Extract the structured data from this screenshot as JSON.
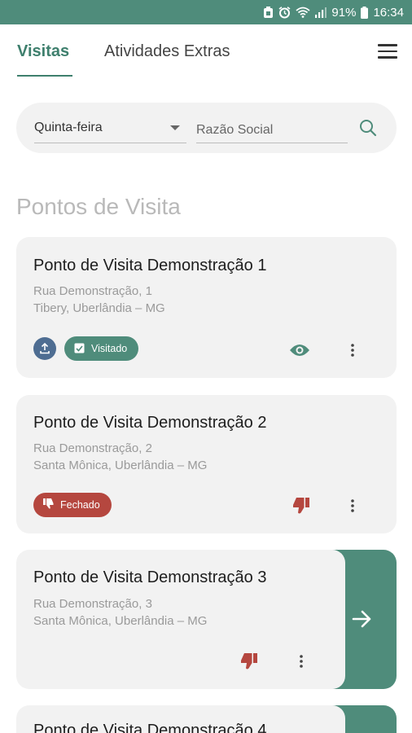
{
  "status_bar": {
    "battery": "91%",
    "time": "16:34"
  },
  "tabs": [
    {
      "label": "Visitas",
      "active": true
    },
    {
      "label": "Atividades Extras",
      "active": false
    }
  ],
  "filter": {
    "day_selected": "Quinta-feira",
    "search_placeholder": "Razão Social"
  },
  "section_title": "Pontos de Visita",
  "cards": [
    {
      "title": "Ponto de Visita Demonstração 1",
      "street": "Rua Demonstração, 1",
      "city": "Tibery, Uberlândia – MG",
      "status": "Visitado",
      "status_color": "#4f8c7b"
    },
    {
      "title": "Ponto de Visita Demonstração 2",
      "street": "Rua Demonstração, 2",
      "city": "Santa Mônica, Uberlândia – MG",
      "status": "Fechado",
      "status_color": "#b5473f"
    },
    {
      "title": "Ponto de Visita Demonstração 3",
      "street": "Rua Demonstração, 3",
      "city": "Santa Mônica, Uberlândia – MG"
    },
    {
      "title": "Ponto de Visita Demonstração 4"
    }
  ],
  "colors": {
    "primary": "#4f8c7b",
    "danger": "#b5473f",
    "upload": "#4e6d92",
    "card_bg": "#f2f2f2"
  }
}
